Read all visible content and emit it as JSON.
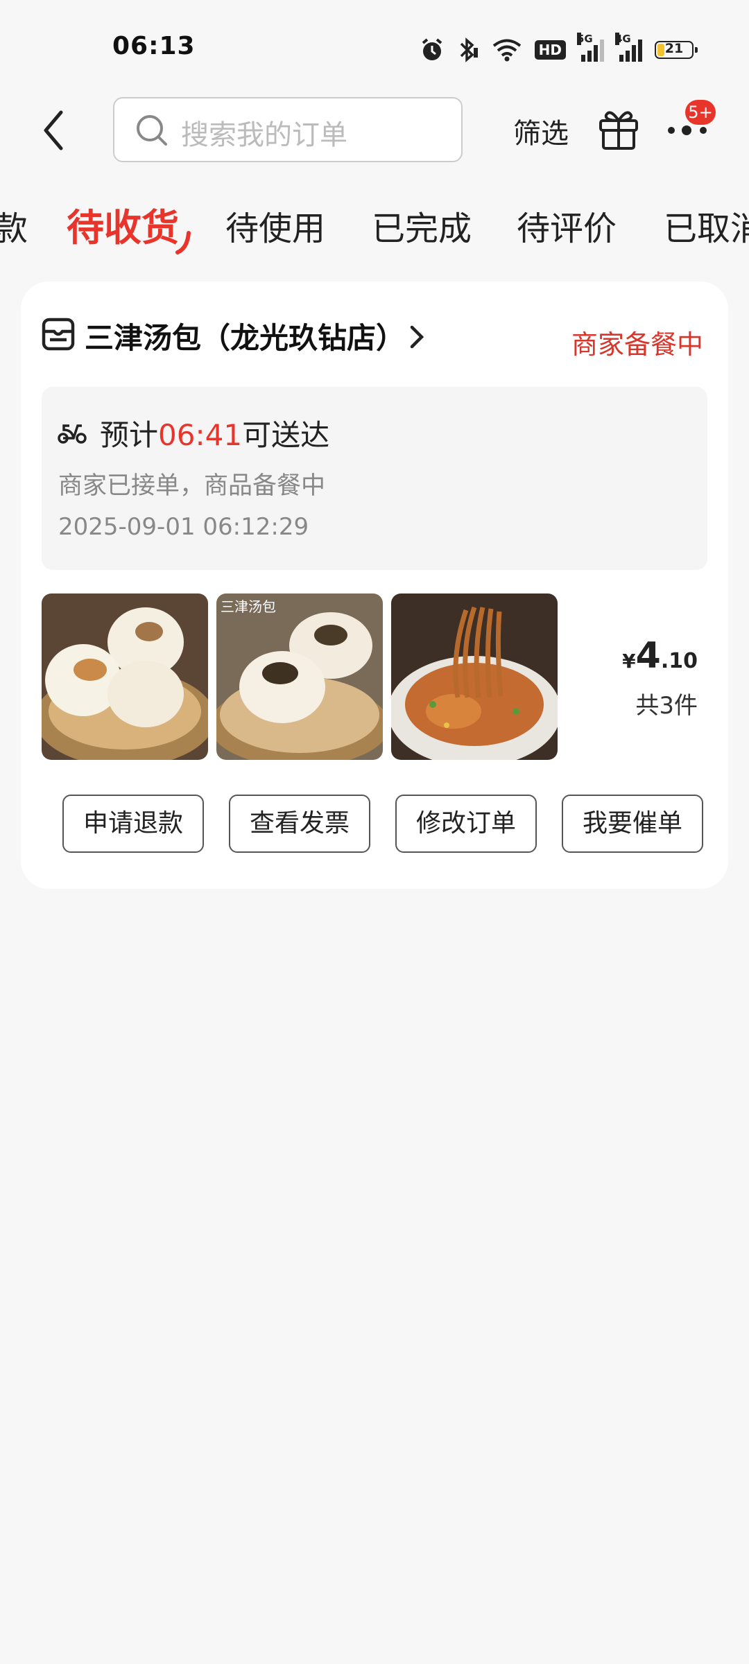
{
  "status_bar": {
    "time": "06:13",
    "icons": [
      "alarm-icon",
      "bluetooth-icon",
      "wifi-icon",
      "hd-icon",
      "5g-signal-icon",
      "4g-signal-icon",
      "battery-icon"
    ],
    "hd_label": "HD",
    "net1": "5G",
    "net2": "4G",
    "battery_level": "21"
  },
  "header": {
    "search_placeholder": "搜索我的订单",
    "filter_label": "筛选",
    "badge": "5+"
  },
  "tabs": [
    {
      "label": "款"
    },
    {
      "label": "待收货",
      "active": true
    },
    {
      "label": "待使用"
    },
    {
      "label": "已完成"
    },
    {
      "label": "待评价"
    },
    {
      "label": "已取消"
    }
  ],
  "order": {
    "store_name": "三津汤包（龙光玖钻店）",
    "status": "商家备餐中",
    "eta_prefix": "预计",
    "eta_time": "06:41",
    "eta_suffix": "可送达",
    "desc": "商家已接单，商品备餐中",
    "timestamp": "2025-09-01 06:12:29",
    "thumb_watermark": "三津汤包",
    "price_symbol": "¥",
    "price_int": "4",
    "price_dec": ".10",
    "count": "共3件",
    "actions": [
      "申请退款",
      "查看发票",
      "修改订单",
      "我要催单"
    ]
  },
  "colors": {
    "accent": "#e8352c",
    "status_red": "#d9362b",
    "background": "#f7f7f7"
  }
}
